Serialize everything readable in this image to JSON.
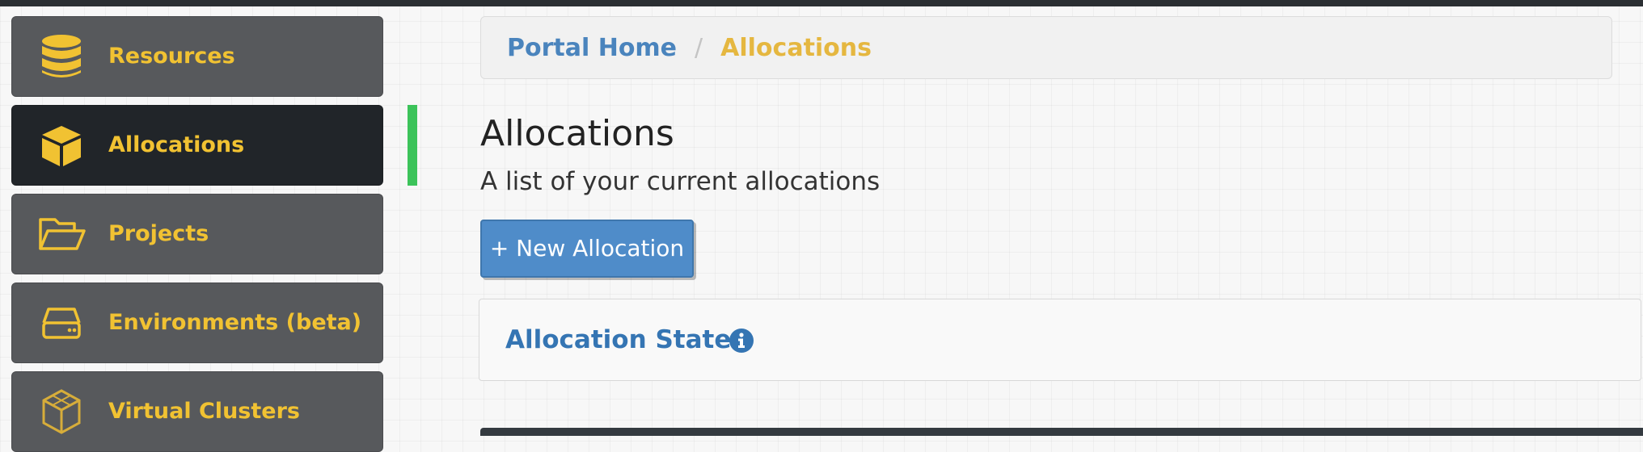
{
  "sidebar": {
    "items": [
      {
        "label": "Resources",
        "icon": "database-icon",
        "active": false
      },
      {
        "label": "Allocations",
        "icon": "cube-icon",
        "active": true
      },
      {
        "label": "Projects",
        "icon": "folder-open-icon",
        "active": false
      },
      {
        "label": "Environments (beta)",
        "icon": "hard-drive-icon",
        "active": false
      },
      {
        "label": "Virtual Clusters",
        "icon": "cluster-cube-icon",
        "active": false
      }
    ]
  },
  "breadcrumb": {
    "home": "Portal Home",
    "separator": "/",
    "current": "Allocations"
  },
  "page": {
    "title": "Allocations",
    "subtitle": "A list of your current allocations"
  },
  "actions": {
    "new_allocation": "+ New Allocation"
  },
  "states_panel": {
    "title": "Allocation States",
    "info_icon": "info-icon"
  },
  "colors": {
    "accent_yellow": "#f1c232",
    "link_blue": "#4a84bd",
    "active_marker": "#3cc35a",
    "button_blue": "#4f8cc9"
  }
}
